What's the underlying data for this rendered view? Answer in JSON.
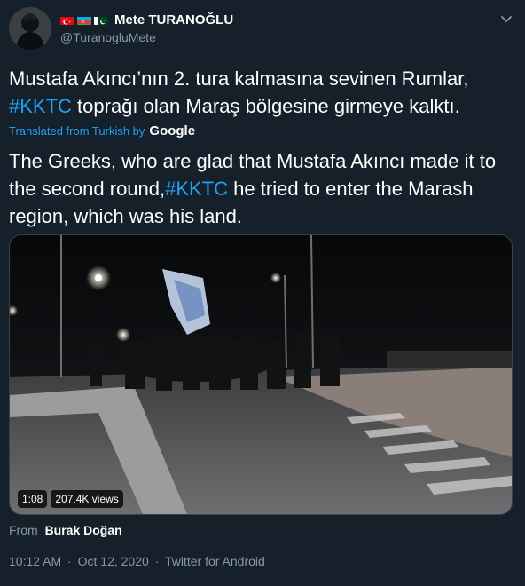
{
  "tweet": {
    "name": "Mete TURANOĞLU",
    "handle": "@TuranogluMete",
    "original_text_1": "Mustafa Akıncı’nın 2. tura kalmasına sevinen Rumlar,",
    "original_hashtag": "#KKTC",
    "original_text_2": " toprağı olan Maraş bölgesine girmeye kalktı.",
    "translated_label": "Translated from Turkish by",
    "translated_provider": "Google",
    "translation_text_1": "The Greeks, who are glad that Mustafa Akıncı made it to the second round,",
    "translation_hashtag": "#KKTC",
    "translation_text_2": " he tried to enter the Marash region, which was his land.",
    "video": {
      "duration": "1:08",
      "views": "207.4K views"
    },
    "from_label": "From",
    "from_name": "Burak Doğan",
    "time": "10:12 AM",
    "date": "Oct 12, 2020",
    "source": "Twitter for Android",
    "separator": "·"
  },
  "flags": [
    "turkey-flag",
    "azerbaijan-flag",
    "pakistan-flag"
  ],
  "icons": {
    "menu": "chevron-down-icon"
  },
  "colors": {
    "background": "#15202b",
    "link": "#1da1f2",
    "secondary_text": "#8899a6",
    "border": "#38444d"
  }
}
